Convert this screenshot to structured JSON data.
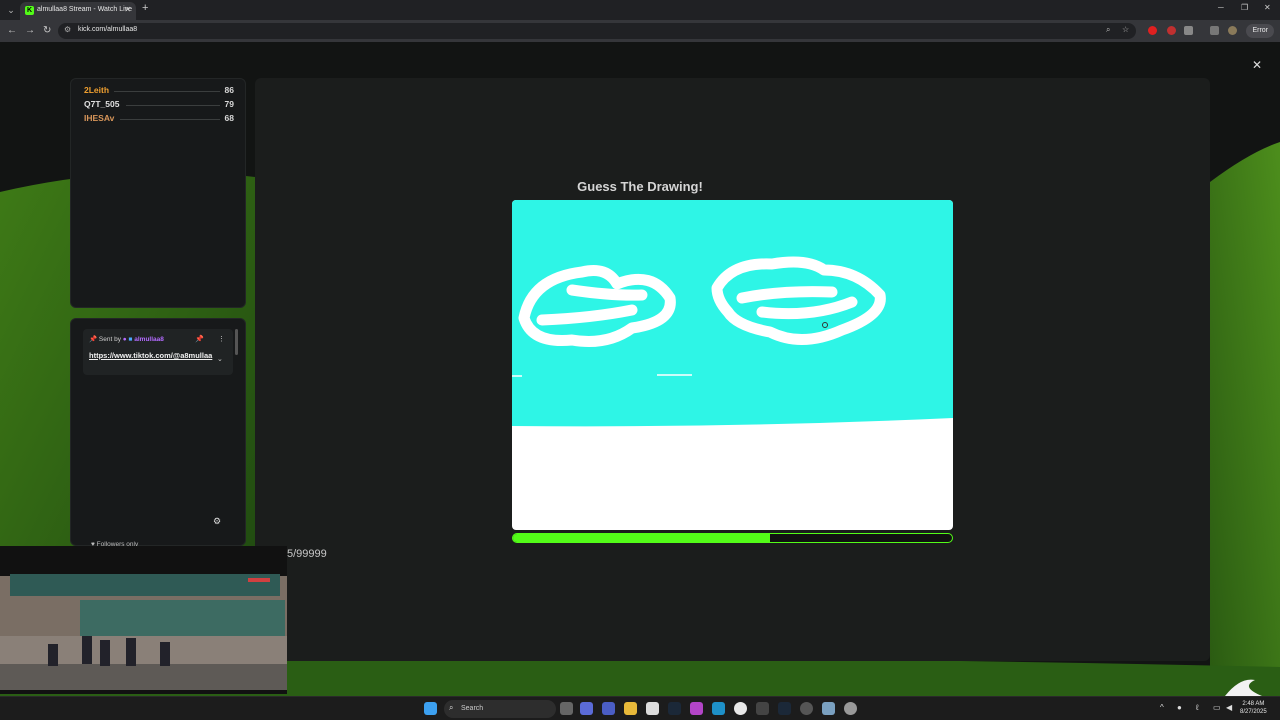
{
  "browser": {
    "tab_title": "almullaa8 Stream - Watch Live",
    "tab_favicon": "K",
    "url": "kick.com/almullaa8",
    "error_label": "Error"
  },
  "leaderboard": [
    {
      "name": "2Leith",
      "score": "86",
      "color": "#f0a030"
    },
    {
      "name": "Q7T_505",
      "score": "79",
      "color": "#e0e0e0"
    },
    {
      "name": "IHESAv",
      "score": "68",
      "color": "#d8965a"
    }
  ],
  "chat": {
    "pinned_sent_by": "Sent by",
    "pinned_user": "almullaa8",
    "pinned_link": "https://www.tiktok.com/@a8mullaa",
    "followers_only": "Followers only",
    "emote_label": "∞"
  },
  "game": {
    "title": "Guess The Drawing!",
    "progress": 0.585,
    "counter": "5/99999",
    "canvas_bg": "#2ef5e6",
    "progress_color": "#53fc18"
  },
  "taskbar": {
    "search_label": "Search",
    "time": "2:48 AM",
    "date": "8/27/2025"
  }
}
